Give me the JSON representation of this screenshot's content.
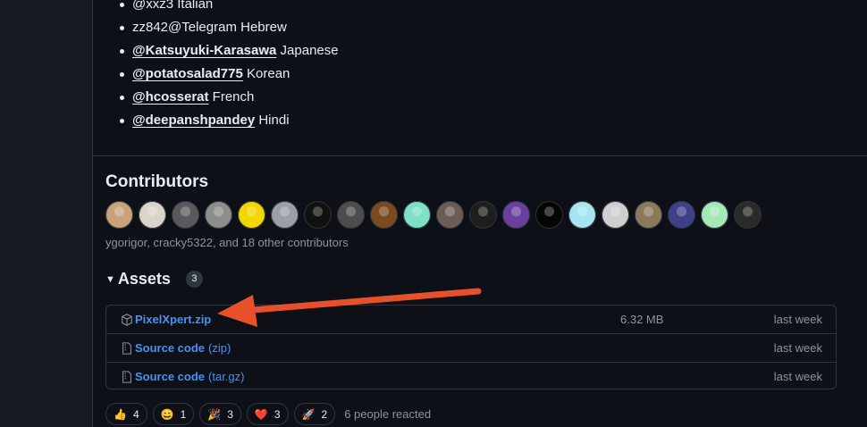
{
  "languages": [
    {
      "handle": "@xxz3",
      "lang": "Italian",
      "link": false
    },
    {
      "handle": "zz842@Telegram",
      "lang": "Hebrew",
      "link": false
    },
    {
      "handle": "@Katsuyuki-Karasawa",
      "lang": "Japanese",
      "link": true
    },
    {
      "handle": "@potatosalad775",
      "lang": "Korean",
      "link": true
    },
    {
      "handle": "@hcosserat",
      "lang": "French",
      "link": true
    },
    {
      "handle": "@deepanshpandey",
      "lang": "Hindi",
      "link": true
    }
  ],
  "contributors": {
    "title": "Contributors",
    "names_text": "ygorigor, cracky5322, and 18 other contributors",
    "avatar_colors": [
      "#c9a27a",
      "#d8d4c8",
      "#5a5a5a",
      "#8d8d8d",
      "#f2d600",
      "#9aa0a6",
      "#111111",
      "#4d4d4d",
      "#7a4b1f",
      "#7ee0c4",
      "#6b5d55",
      "#1e1e1e",
      "#6b3fa0",
      "#050505",
      "#a7e5f0",
      "#cfcfcf",
      "#8a7a5a",
      "#3f3f8a",
      "#a5e8b5",
      "#2a2a2a"
    ]
  },
  "assets": {
    "title": "Assets",
    "count": "3",
    "rows": [
      {
        "name": "PixelXpert.zip",
        "suffix": "",
        "size": "6.32 MB",
        "date": "last week",
        "icon": "package-icon"
      },
      {
        "name": "Source code",
        "suffix": "(zip)",
        "size": "",
        "date": "last week",
        "icon": "file-zip-icon"
      },
      {
        "name": "Source code",
        "suffix": "(tar.gz)",
        "size": "",
        "date": "last week",
        "icon": "file-zip-icon"
      }
    ]
  },
  "reactions": {
    "items": [
      {
        "emoji": "👍",
        "count": "4"
      },
      {
        "emoji": "😄",
        "count": "1"
      },
      {
        "emoji": "🎉",
        "count": "3"
      },
      {
        "emoji": "❤️",
        "count": "3"
      },
      {
        "emoji": "🚀",
        "count": "2"
      }
    ],
    "summary": "6 people reacted"
  },
  "colors": {
    "accent_link": "#4493f8",
    "arrow": "#e8502b",
    "bg": "#0d1117"
  }
}
